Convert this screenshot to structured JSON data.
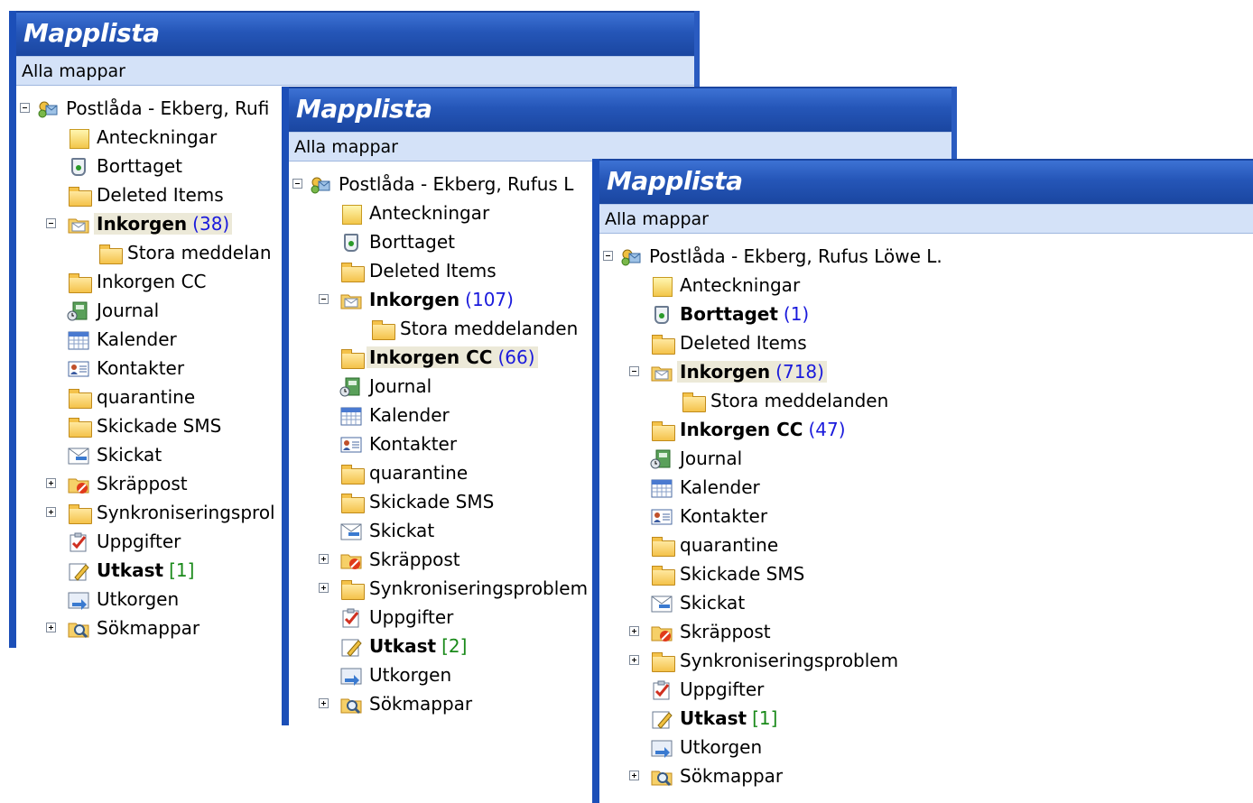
{
  "panel1": {
    "title": "Mapplista",
    "subtitle": "Alla mappar",
    "rows": [
      {
        "label": "Postlåda - Ekberg, Rufi",
        "count": "",
        "bold": false,
        "sel": false,
        "exp": "minus",
        "indent": 0,
        "icon": "mailbox-icon"
      },
      {
        "label": "Anteckningar",
        "count": "",
        "bold": false,
        "sel": false,
        "exp": "",
        "indent": 1,
        "icon": "notes-icon"
      },
      {
        "label": "Borttaget",
        "count": "",
        "bold": false,
        "sel": false,
        "exp": "",
        "indent": 1,
        "icon": "trash-icon"
      },
      {
        "label": "Deleted Items",
        "count": "",
        "bold": false,
        "sel": false,
        "exp": "",
        "indent": 1,
        "icon": "folder-icon"
      },
      {
        "label": "Inkorgen",
        "count": "(38)",
        "bold": true,
        "sel": true,
        "exp": "minus",
        "indent": 1,
        "icon": "inbox-icon"
      },
      {
        "label": "Stora meddelan",
        "count": "",
        "bold": false,
        "sel": false,
        "exp": "",
        "indent": 2,
        "icon": "folder-icon"
      },
      {
        "label": "Inkorgen CC",
        "count": "",
        "bold": false,
        "sel": false,
        "exp": "",
        "indent": 1,
        "icon": "folder-icon"
      },
      {
        "label": "Journal",
        "count": "",
        "bold": false,
        "sel": false,
        "exp": "",
        "indent": 1,
        "icon": "journal-icon"
      },
      {
        "label": "Kalender",
        "count": "",
        "bold": false,
        "sel": false,
        "exp": "",
        "indent": 1,
        "icon": "calendar-icon"
      },
      {
        "label": "Kontakter",
        "count": "",
        "bold": false,
        "sel": false,
        "exp": "",
        "indent": 1,
        "icon": "contacts-icon"
      },
      {
        "label": "quarantine",
        "count": "",
        "bold": false,
        "sel": false,
        "exp": "",
        "indent": 1,
        "icon": "folder-icon"
      },
      {
        "label": "Skickade SMS",
        "count": "",
        "bold": false,
        "sel": false,
        "exp": "",
        "indent": 1,
        "icon": "folder-icon"
      },
      {
        "label": "Skickat",
        "count": "",
        "bold": false,
        "sel": false,
        "exp": "",
        "indent": 1,
        "icon": "sent-icon"
      },
      {
        "label": "Skräppost",
        "count": "",
        "bold": false,
        "sel": false,
        "exp": "plus",
        "indent": 1,
        "icon": "junk-icon"
      },
      {
        "label": "Synkroniseringsprol",
        "count": "",
        "bold": false,
        "sel": false,
        "exp": "plus",
        "indent": 1,
        "icon": "folder-icon"
      },
      {
        "label": "Uppgifter",
        "count": "",
        "bold": false,
        "sel": false,
        "exp": "",
        "indent": 1,
        "icon": "tasks-icon"
      },
      {
        "label": "Utkast",
        "count": "[1]",
        "bold": true,
        "sel": false,
        "exp": "",
        "indent": 1,
        "icon": "drafts-icon",
        "green": true
      },
      {
        "label": "Utkorgen",
        "count": "",
        "bold": false,
        "sel": false,
        "exp": "",
        "indent": 1,
        "icon": "outbox-icon"
      },
      {
        "label": "Sökmappar",
        "count": "",
        "bold": false,
        "sel": false,
        "exp": "plus",
        "indent": 1,
        "icon": "search-folder-icon"
      }
    ]
  },
  "panel2": {
    "title": "Mapplista",
    "subtitle": "Alla mappar",
    "rows": [
      {
        "label": "Postlåda - Ekberg, Rufus L",
        "count": "",
        "bold": false,
        "sel": false,
        "exp": "minus",
        "indent": 0,
        "icon": "mailbox-icon"
      },
      {
        "label": "Anteckningar",
        "count": "",
        "bold": false,
        "sel": false,
        "exp": "",
        "indent": 1,
        "icon": "notes-icon"
      },
      {
        "label": "Borttaget",
        "count": "",
        "bold": false,
        "sel": false,
        "exp": "",
        "indent": 1,
        "icon": "trash-icon"
      },
      {
        "label": "Deleted Items",
        "count": "",
        "bold": false,
        "sel": false,
        "exp": "",
        "indent": 1,
        "icon": "folder-icon"
      },
      {
        "label": "Inkorgen",
        "count": "(107)",
        "bold": true,
        "sel": false,
        "exp": "minus",
        "indent": 1,
        "icon": "inbox-icon"
      },
      {
        "label": "Stora meddelanden",
        "count": "",
        "bold": false,
        "sel": false,
        "exp": "",
        "indent": 2,
        "icon": "folder-icon"
      },
      {
        "label": "Inkorgen CC",
        "count": "(66)",
        "bold": true,
        "sel": true,
        "exp": "",
        "indent": 1,
        "icon": "folder-icon"
      },
      {
        "label": "Journal",
        "count": "",
        "bold": false,
        "sel": false,
        "exp": "",
        "indent": 1,
        "icon": "journal-icon"
      },
      {
        "label": "Kalender",
        "count": "",
        "bold": false,
        "sel": false,
        "exp": "",
        "indent": 1,
        "icon": "calendar-icon"
      },
      {
        "label": "Kontakter",
        "count": "",
        "bold": false,
        "sel": false,
        "exp": "",
        "indent": 1,
        "icon": "contacts-icon"
      },
      {
        "label": "quarantine",
        "count": "",
        "bold": false,
        "sel": false,
        "exp": "",
        "indent": 1,
        "icon": "folder-icon"
      },
      {
        "label": "Skickade SMS",
        "count": "",
        "bold": false,
        "sel": false,
        "exp": "",
        "indent": 1,
        "icon": "folder-icon"
      },
      {
        "label": "Skickat",
        "count": "",
        "bold": false,
        "sel": false,
        "exp": "",
        "indent": 1,
        "icon": "sent-icon"
      },
      {
        "label": "Skräppost",
        "count": "",
        "bold": false,
        "sel": false,
        "exp": "plus",
        "indent": 1,
        "icon": "junk-icon"
      },
      {
        "label": "Synkroniseringsproblem",
        "count": "",
        "bold": false,
        "sel": false,
        "exp": "plus",
        "indent": 1,
        "icon": "folder-icon"
      },
      {
        "label": "Uppgifter",
        "count": "",
        "bold": false,
        "sel": false,
        "exp": "",
        "indent": 1,
        "icon": "tasks-icon"
      },
      {
        "label": "Utkast",
        "count": "[2]",
        "bold": true,
        "sel": false,
        "exp": "",
        "indent": 1,
        "icon": "drafts-icon",
        "green": true
      },
      {
        "label": "Utkorgen",
        "count": "",
        "bold": false,
        "sel": false,
        "exp": "",
        "indent": 1,
        "icon": "outbox-icon"
      },
      {
        "label": "Sökmappar",
        "count": "",
        "bold": false,
        "sel": false,
        "exp": "plus",
        "indent": 1,
        "icon": "search-folder-icon"
      }
    ]
  },
  "panel3": {
    "title": "Mapplista",
    "subtitle": "Alla mappar",
    "rows": [
      {
        "label": "Postlåda - Ekberg, Rufus Löwe L.",
        "count": "",
        "bold": false,
        "sel": false,
        "exp": "minus",
        "indent": 0,
        "icon": "mailbox-icon"
      },
      {
        "label": "Anteckningar",
        "count": "",
        "bold": false,
        "sel": false,
        "exp": "",
        "indent": 1,
        "icon": "notes-icon"
      },
      {
        "label": "Borttaget",
        "count": "(1)",
        "bold": true,
        "sel": false,
        "exp": "",
        "indent": 1,
        "icon": "trash-icon"
      },
      {
        "label": "Deleted Items",
        "count": "",
        "bold": false,
        "sel": false,
        "exp": "",
        "indent": 1,
        "icon": "folder-icon"
      },
      {
        "label": "Inkorgen",
        "count": "(718)",
        "bold": true,
        "sel": true,
        "exp": "minus",
        "indent": 1,
        "icon": "inbox-icon"
      },
      {
        "label": "Stora meddelanden",
        "count": "",
        "bold": false,
        "sel": false,
        "exp": "",
        "indent": 2,
        "icon": "folder-icon"
      },
      {
        "label": "Inkorgen CC",
        "count": "(47)",
        "bold": true,
        "sel": false,
        "exp": "",
        "indent": 1,
        "icon": "folder-icon"
      },
      {
        "label": "Journal",
        "count": "",
        "bold": false,
        "sel": false,
        "exp": "",
        "indent": 1,
        "icon": "journal-icon"
      },
      {
        "label": "Kalender",
        "count": "",
        "bold": false,
        "sel": false,
        "exp": "",
        "indent": 1,
        "icon": "calendar-icon"
      },
      {
        "label": "Kontakter",
        "count": "",
        "bold": false,
        "sel": false,
        "exp": "",
        "indent": 1,
        "icon": "contacts-icon"
      },
      {
        "label": "quarantine",
        "count": "",
        "bold": false,
        "sel": false,
        "exp": "",
        "indent": 1,
        "icon": "folder-icon"
      },
      {
        "label": "Skickade SMS",
        "count": "",
        "bold": false,
        "sel": false,
        "exp": "",
        "indent": 1,
        "icon": "folder-icon"
      },
      {
        "label": "Skickat",
        "count": "",
        "bold": false,
        "sel": false,
        "exp": "",
        "indent": 1,
        "icon": "sent-icon"
      },
      {
        "label": "Skräppost",
        "count": "",
        "bold": false,
        "sel": false,
        "exp": "plus",
        "indent": 1,
        "icon": "junk-icon"
      },
      {
        "label": "Synkroniseringsproblem",
        "count": "",
        "bold": false,
        "sel": false,
        "exp": "plus",
        "indent": 1,
        "icon": "folder-icon"
      },
      {
        "label": "Uppgifter",
        "count": "",
        "bold": false,
        "sel": false,
        "exp": "",
        "indent": 1,
        "icon": "tasks-icon"
      },
      {
        "label": "Utkast",
        "count": "[1]",
        "bold": true,
        "sel": false,
        "exp": "",
        "indent": 1,
        "icon": "drafts-icon",
        "green": true
      },
      {
        "label": "Utkorgen",
        "count": "",
        "bold": false,
        "sel": false,
        "exp": "",
        "indent": 1,
        "icon": "outbox-icon"
      },
      {
        "label": "Sökmappar",
        "count": "",
        "bold": false,
        "sel": false,
        "exp": "plus",
        "indent": 1,
        "icon": "search-folder-icon"
      }
    ]
  }
}
